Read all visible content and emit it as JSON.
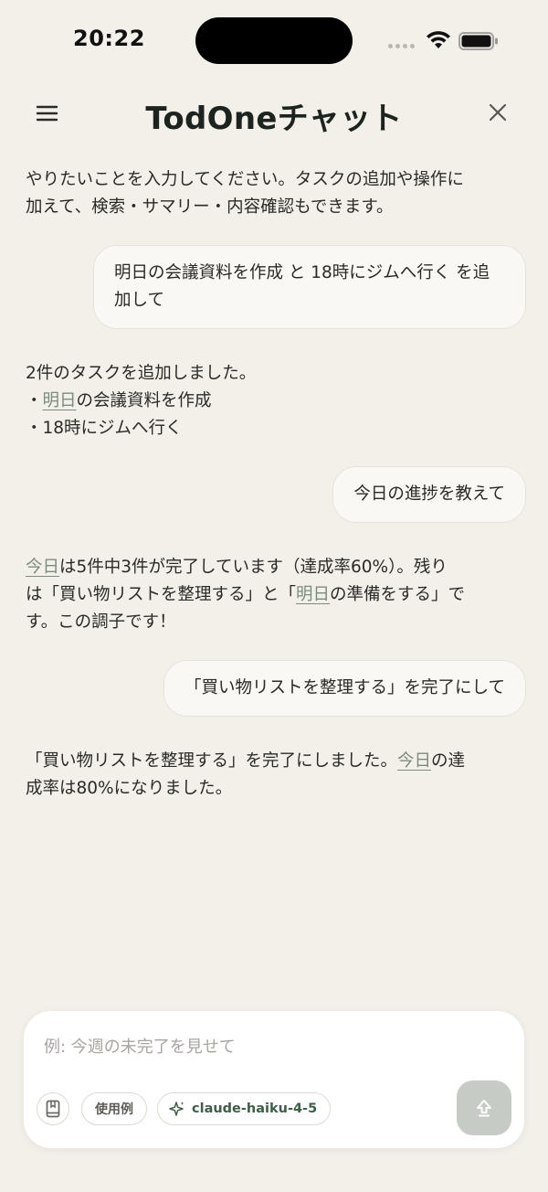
{
  "status_bar": {
    "time": "20:22"
  },
  "header": {
    "title": "TodOneチャット"
  },
  "messages": [
    {
      "role": "assistant",
      "parts": [
        {
          "text": "やりたいことを入力してください。タスクの追加や操作に\n加えて、検索・サマリー・内容確認もできます。"
        }
      ]
    },
    {
      "role": "user",
      "parts": [
        {
          "text": "明日の会議資料を作成 と 18時にジムへ行く を追加して"
        }
      ]
    },
    {
      "role": "assistant",
      "parts": [
        {
          "text": "2件のタスクを追加しました。\n・"
        },
        {
          "text": "明日",
          "link": true
        },
        {
          "text": "の会議資料を作成\n・18時にジムへ行く"
        }
      ]
    },
    {
      "role": "user",
      "parts": [
        {
          "text": "今日の進捗を教えて"
        }
      ]
    },
    {
      "role": "assistant",
      "parts": [
        {
          "text": "今日",
          "link": true
        },
        {
          "text": "は5件中3件が完了しています（達成率60%）。残り\nは「買い物リストを整理する」と「"
        },
        {
          "text": "明日",
          "link": true
        },
        {
          "text": "の準備をする」で\nす。この調子です！"
        }
      ]
    },
    {
      "role": "user",
      "parts": [
        {
          "text": "「買い物リストを整理する」を完了にして"
        }
      ]
    },
    {
      "role": "assistant",
      "parts": [
        {
          "text": "「買い物リストを整理する」を完了にしました。"
        },
        {
          "text": "今日",
          "link": true
        },
        {
          "text": "の達\n成率は80%になりました。"
        }
      ]
    }
  ],
  "composer": {
    "placeholder": "例: 今週の未完了を見せて",
    "value": "",
    "examples_label": "使用例",
    "model_label": "claude-haiku-4-5"
  },
  "icons": {
    "menu": "hamburger-icon",
    "close": "close-icon",
    "book": "book-icon",
    "model": "sparkle-icon",
    "send": "send-arrow-icon"
  },
  "colors": {
    "background": "#f3f0ea",
    "link": "#7b8c7c",
    "accent": "#3f5e47",
    "send_disabled": "#c6cbc5"
  }
}
